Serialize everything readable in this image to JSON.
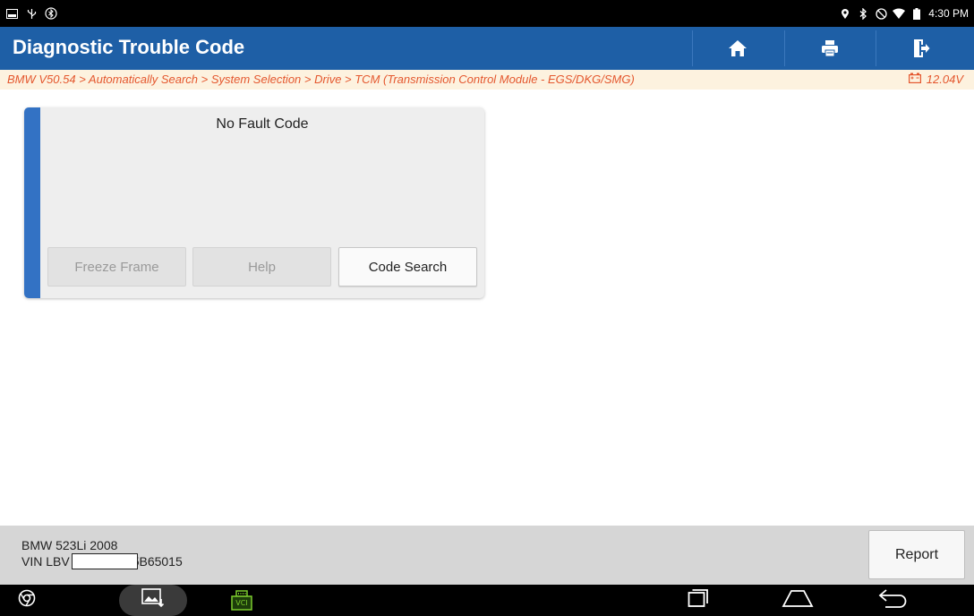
{
  "status_bar": {
    "left_icons": [
      "screenshot-icon",
      "usb-icon",
      "bluetooth-circle-icon"
    ],
    "right_icons": [
      "location-icon",
      "bluetooth-icon",
      "do-not-disturb-icon",
      "wifi-icon",
      "battery-icon"
    ],
    "time": "4:30 PM"
  },
  "title_bar": {
    "title": "Diagnostic Trouble Code",
    "buttons": [
      "home-icon",
      "print-icon",
      "exit-icon"
    ],
    "color": "#1e5fa6"
  },
  "breadcrumb": {
    "path": "BMW V50.54 > Automatically Search > System Selection > Drive > TCM (Transmission Control Module - EGS/DKG/SMG)",
    "voltage": "12.04V",
    "color": "#e4572e"
  },
  "dtc_card": {
    "message": "No Fault Code",
    "buttons": {
      "freeze_frame": "Freeze Frame",
      "help": "Help",
      "code_search": "Code Search"
    },
    "accent_color": "#3372c4"
  },
  "info_bar": {
    "vehicle": "BMW 523Li 2008",
    "vin_prefix": "VIN LBV",
    "vin_suffix": "5B65015",
    "report_label": "Report"
  },
  "nav_bar": {
    "icons": [
      "chrome-icon",
      "gallery-icon",
      "vci-icon",
      "recent-apps-icon",
      "home-nav-icon",
      "back-icon"
    ],
    "vci_label": "VCI"
  }
}
